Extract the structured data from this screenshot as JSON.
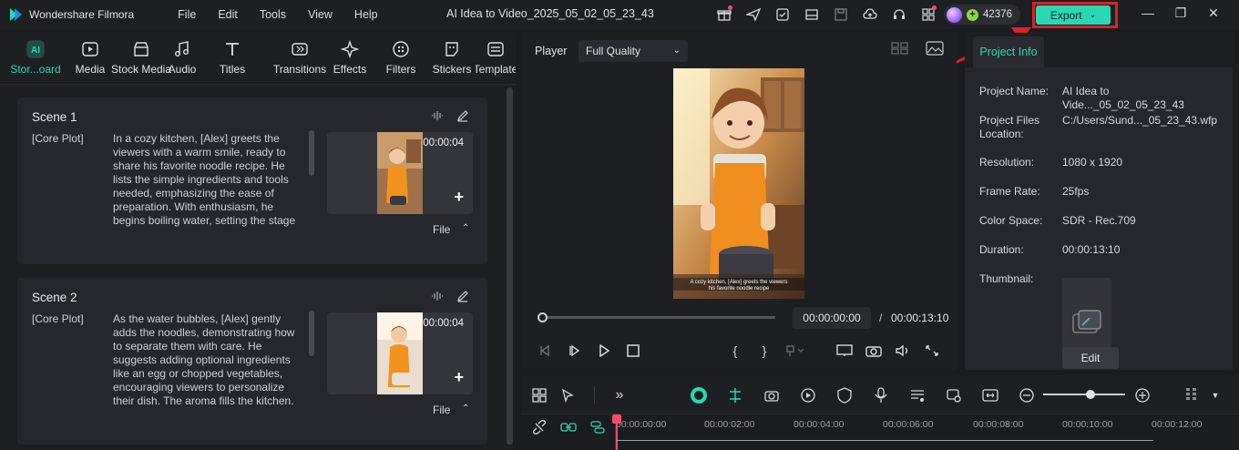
{
  "app": {
    "name": "Wondershare Filmora",
    "project_title": "AI Idea to Video_2025_05_02_05_23_43",
    "menu": [
      "File",
      "Edit",
      "Tools",
      "View",
      "Help"
    ],
    "credits": "42376",
    "export_label": "Export",
    "accent": "#2ad7b3",
    "highlight": "#d9222b"
  },
  "toolbar": {
    "items": [
      {
        "label": "Stor...oard",
        "icon": "storyboard-icon"
      },
      {
        "label": "Media",
        "icon": "media-icon"
      },
      {
        "label": "Stock Media",
        "icon": "stock-media-icon"
      },
      {
        "label": "Audio",
        "icon": "audio-icon"
      },
      {
        "label": "Titles",
        "icon": "titles-icon"
      },
      {
        "label": "Transitions",
        "icon": "transitions-icon"
      },
      {
        "label": "Effects",
        "icon": "effects-icon"
      },
      {
        "label": "Filters",
        "icon": "filters-icon"
      },
      {
        "label": "Stickers",
        "icon": "stickers-icon"
      },
      {
        "label": "Template",
        "icon": "templates-icon"
      }
    ]
  },
  "scenes": [
    {
      "title": "Scene 1",
      "tag": "[Core Plot]",
      "text": "In a cozy kitchen, [Alex] greets the viewers with a warm smile, ready to share his favorite noodle recipe. He lists the simple ingredients and tools needed, emphasizing the ease of preparation. With enthusiasm, he begins boiling water, setting the stage",
      "duration": "00:00:04",
      "file_label": "File"
    },
    {
      "title": "Scene 2",
      "tag": "[Core Plot]",
      "text": "As the water bubbles, [Alex] gently adds the noodles, demonstrating how to separate them with care. He suggests adding optional ingredients like an egg or chopped vegetables, encouraging viewers to personalize their dish. The aroma fills the kitchen.",
      "duration": "00:00:04",
      "file_label": "File"
    }
  ],
  "player": {
    "label": "Player",
    "quality": "Full Quality",
    "current_time": "00:00:00:00",
    "separator": "/",
    "total_time": "00:00:13:10",
    "progress_fraction": 0.0
  },
  "project_info": {
    "tab": "Project Info",
    "rows": [
      {
        "key": "Project Name:",
        "value": "AI Idea to Vide..._05_02_05_23_43"
      },
      {
        "key": "Project Files Location:",
        "value": "C:/Users/Sund..._05_23_43.wfp"
      },
      {
        "key": "Resolution:",
        "value": "1080 x 1920"
      },
      {
        "key": "Frame Rate:",
        "value": "25fps"
      },
      {
        "key": "Color Space:",
        "value": "SDR - Rec.709"
      },
      {
        "key": "Duration:",
        "value": "00:00:13:10"
      }
    ],
    "thumbnail_label": "Thumbnail:",
    "edit_label": "Edit"
  },
  "timeline": {
    "ruler": [
      "00:00:00:00",
      "00:00:02:00",
      "00:00:04:00",
      "00:00:06:00",
      "00:00:08:00",
      "00:00:10:00",
      "00:00:12:00"
    ],
    "zoom_fraction": 0.58
  }
}
